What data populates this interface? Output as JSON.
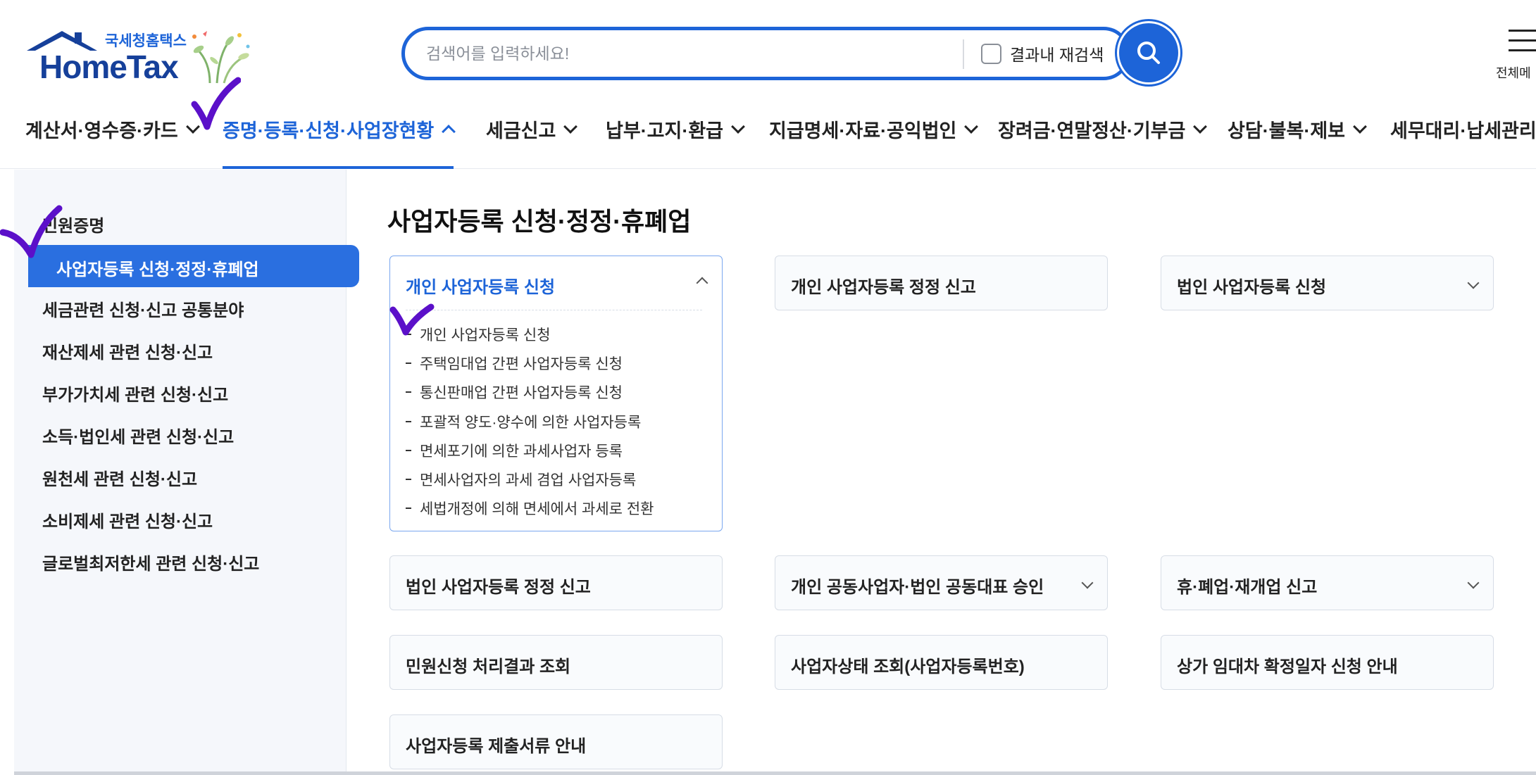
{
  "logo": {
    "sub": "국세청홈택스",
    "main": "HomeTax"
  },
  "search": {
    "placeholder": "검색어를 입력하세요!",
    "value": "",
    "research_label": "결과내 재검색"
  },
  "allmenu_label": "전체메",
  "gnb": [
    {
      "label": "계산서·영수증·카드",
      "active": false
    },
    {
      "label": "증명·등록·신청·사업장현황",
      "active": true
    },
    {
      "label": "세금신고",
      "active": false
    },
    {
      "label": "납부·고지·환급",
      "active": false
    },
    {
      "label": "지급명세·자료·공익법인",
      "active": false
    },
    {
      "label": "장려금·연말정산·기부금",
      "active": false
    },
    {
      "label": "상담·불복·제보",
      "active": false
    },
    {
      "label": "세무대리·납세관리",
      "active": false
    }
  ],
  "side": {
    "items": [
      "민원증명",
      "사업자등록 신청·정정·휴폐업",
      "세금관련 신청·신고 공통분야",
      "재산제세 관련 신청·신고",
      "부가가치세 관련 신청·신고",
      "소득·법인세 관련 신청·신고",
      "원천세 관련 신청·신고",
      "소비제세 관련 신청·신고",
      "글로벌최저한세 관련 신청·신고"
    ],
    "active_index": 1
  },
  "main": {
    "title": "사업자등록 신청·정정·휴폐업",
    "cards": [
      {
        "label": "개인 사업자등록 신청",
        "expanded": true,
        "has_chevron": true,
        "sub_items": [
          "개인 사업자등록 신청",
          "주택임대업 간편 사업자등록 신청",
          "통신판매업 간편 사업자등록 신청",
          "포괄적 양도·양수에 의한 사업자등록",
          "면세포기에 의한 과세사업자 등록",
          "면세사업자의 과세 겸업 사업자등록",
          "세법개정에 의해 면세에서 과세로 전환"
        ]
      },
      {
        "label": "개인 사업자등록 정정 신고",
        "has_chevron": false
      },
      {
        "label": "법인 사업자등록 신청",
        "has_chevron": true
      },
      {
        "label": "법인 사업자등록 정정 신고",
        "has_chevron": false
      },
      {
        "label": "개인 공동사업자·법인 공동대표 승인",
        "has_chevron": true
      },
      {
        "label": "휴·폐업·재개업 신고",
        "has_chevron": true
      },
      {
        "label": "민원신청 처리결과 조회",
        "has_chevron": false
      },
      {
        "label": "사업자상태 조회(사업자등록번호)",
        "has_chevron": false
      },
      {
        "label": "상가 임대차 확정일자 신청 안내",
        "has_chevron": false
      },
      {
        "label": "사업자등록 제출서류 안내",
        "has_chevron": false
      }
    ]
  },
  "colors": {
    "brand": "#1d64d8",
    "logo_text": "#16409a",
    "annotation": "#5b10c9"
  }
}
